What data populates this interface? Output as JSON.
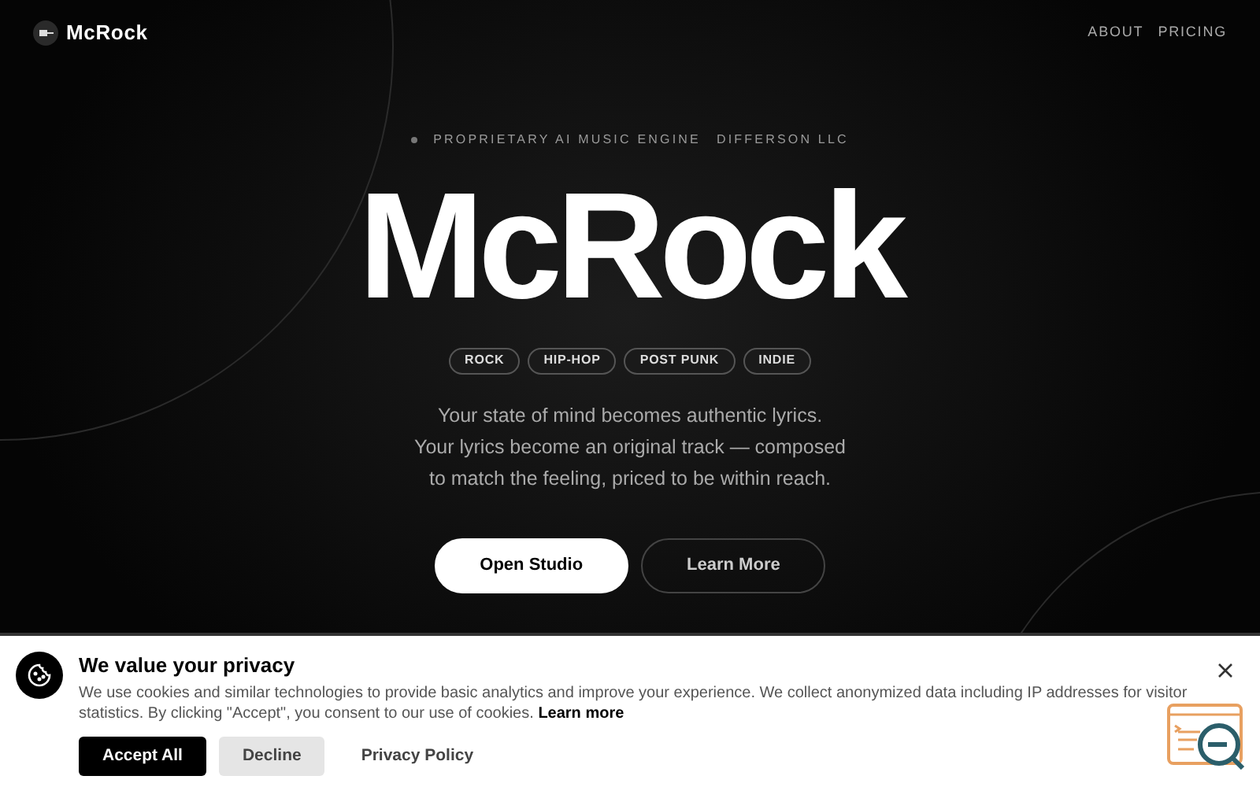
{
  "nav": {
    "brand": "McRock",
    "links": [
      "ABOUT",
      "PRICING"
    ]
  },
  "hero": {
    "eyebrow": [
      "PROPRIETARY AI MUSIC ENGINE",
      "DIFFERSON LLC"
    ],
    "title": "McRock",
    "tags": [
      "ROCK",
      "HIP-HOP",
      "POST PUNK",
      "INDIE"
    ],
    "lines": [
      "Your state of mind becomes authentic lyrics.",
      "Your lyrics become an original track — composed",
      "to match the feeling, priced to be within reach."
    ],
    "buttons": [
      {
        "label": "Open Studio",
        "kind": "primary"
      },
      {
        "label": "Learn More",
        "kind": "outline"
      }
    ]
  },
  "cookie": {
    "title": "We value your privacy",
    "text": "We use cookies and similar technologies to provide basic analytics and improve your experience. We collect anonymized data including IP addresses for visitor statistics. By clicking \"Accept\", you consent to our use of cookies.",
    "link": "Learn more",
    "buttons": [
      {
        "label": "Accept All",
        "kind": "primary"
      },
      {
        "label": "Decline",
        "kind": "secondary"
      },
      {
        "label": "Privacy Policy",
        "kind": "plain"
      }
    ]
  }
}
